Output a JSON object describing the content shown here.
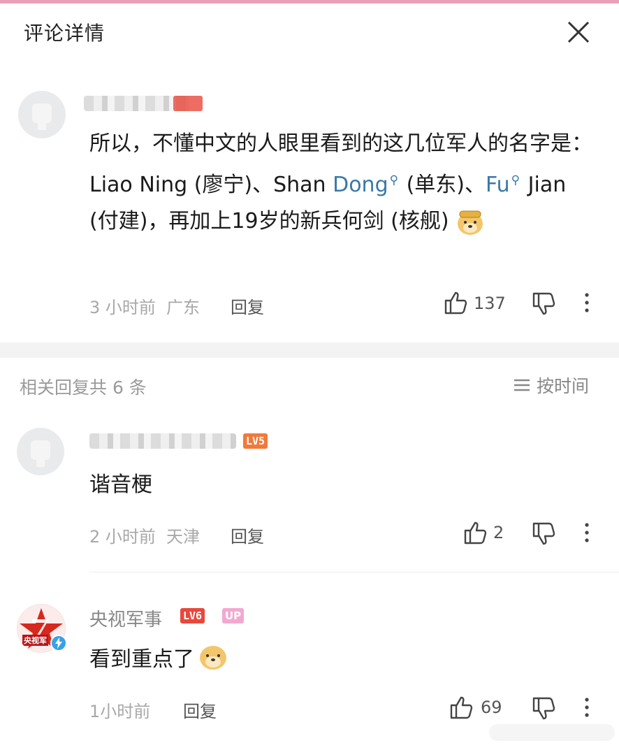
{
  "header": {
    "title": "评论详情"
  },
  "main_comment": {
    "text_parts": {
      "p1": "所以，不懂中文的人眼里看到的这几位军人的名字是：Liao Ning (廖宁)、Shan ",
      "link1": "Dong",
      "p2": " (单东)、",
      "link2": "Fu",
      "p3": " Jian (付建)，再加上19岁的新兵何剑 (核舰)"
    },
    "time": "3 小时前",
    "location": "广东",
    "reply_label": "回复",
    "like_count": "137"
  },
  "replies_section": {
    "title": "相关回复共 6 条",
    "sort_label": "按时间"
  },
  "replies": [
    {
      "level": "LV5",
      "text": "谐音梗",
      "time": "2 小时前",
      "location": "天津",
      "reply_label": "回复",
      "like_count": "2"
    },
    {
      "name": "央视军事",
      "level": "LV6",
      "badge": "UP",
      "avatar_text": "央视军",
      "text": "看到重点了",
      "time": "1小时前",
      "reply_label": "回复",
      "like_count": "69"
    }
  ],
  "colors": {
    "link": "#3a78a8",
    "meta": "#a8a8a8",
    "level_orange": "#f07a3c",
    "level_red": "#e8483c",
    "up_pink": "#f3a8d0"
  }
}
